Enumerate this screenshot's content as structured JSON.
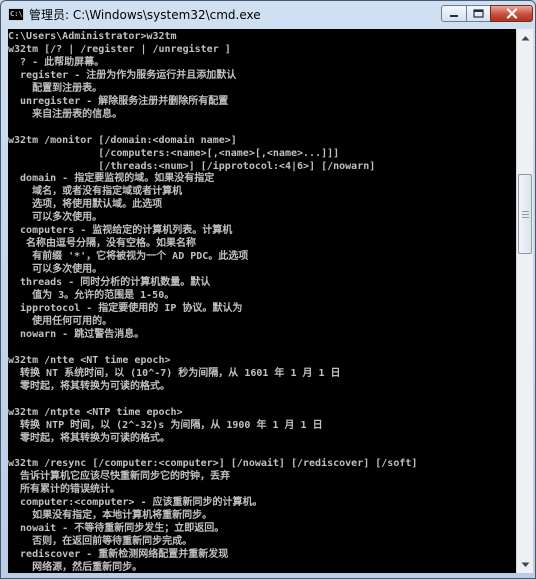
{
  "window": {
    "title": "管理员: C:\\Windows\\system32\\cmd.exe",
    "icon_text": "C:\\",
    "controls": {
      "minimize_icon": "minimize-icon",
      "maximize_icon": "maximize-icon",
      "close_icon": "close-icon"
    }
  },
  "console": {
    "lines": [
      "C:\\Users\\Administrator>w32tm",
      "w32tm [/? | /register | /unregister ]",
      "  ? - 此帮助屏幕。",
      "  register - 注册为作为服务运行并且添加默认",
      "    配置到注册表。",
      "  unregister - 解除服务注册并删除所有配置",
      "    来自注册表的信息。",
      "",
      "w32tm /monitor [/domain:<domain name>]",
      "               [/computers:<name>[,<name>[,<name>...]]]",
      "               [/threads:<num>] [/ipprotocol:<4|6>] [/nowarn]",
      "  domain - 指定要监视的域。如果没有指定",
      "    域名，或者没有指定域或者计算机",
      "    选项，将使用默认域。此选项",
      "    可以多次使用。",
      "  computers - 监视给定的计算机列表。计算机",
      "   名称由逗号分隔，没有空格。如果名称",
      "    有前缀 '*'，它将被视为一个 AD PDC。此选项",
      "    可以多次使用。",
      "  threads - 同时分析的计算机数量。默认",
      "    值为 3。允许的范围是 1-50。",
      "  ipprotocol - 指定要使用的 IP 协议。默认为",
      "    使用任何可用的。",
      "  nowarn - 跳过警告消息。",
      "",
      "w32tm /ntte <NT time epoch>",
      "  转换 NT 系统时间，以 (10^-7) 秒为间隔，从 1601 年 1 月 1 日",
      "  零时起，将其转换为可读的格式。",
      "",
      "w32tm /ntpte <NTP time epoch>",
      "  转换 NTP 时间，以 (2^-32)s 为间隔，从 1900 年 1 月 1 日",
      "  零时起，将其转换为可读的格式。",
      "",
      "w32tm /resync [/computer:<computer>] [/nowait] [/rediscover] [/soft]",
      "  告诉计算机它应该尽快重新同步它的时钟，丢弃",
      "  所有累计的错误统计。",
      "  computer:<computer> - 应该重新同步的计算机。",
      "    如果没有指定，本地计算机将重新同步。",
      "  nowait - 不等待重新同步发生；立即返回。",
      "    否则，在返回前等待重新同步完成。",
      "  rediscover - 重新检测网络配置并重新发现",
      "    网络源，然后重新同步。"
    ]
  },
  "scrollbar": {
    "up_icon": "scroll-up-arrow-icon",
    "down_icon": "scroll-down-arrow-icon"
  }
}
